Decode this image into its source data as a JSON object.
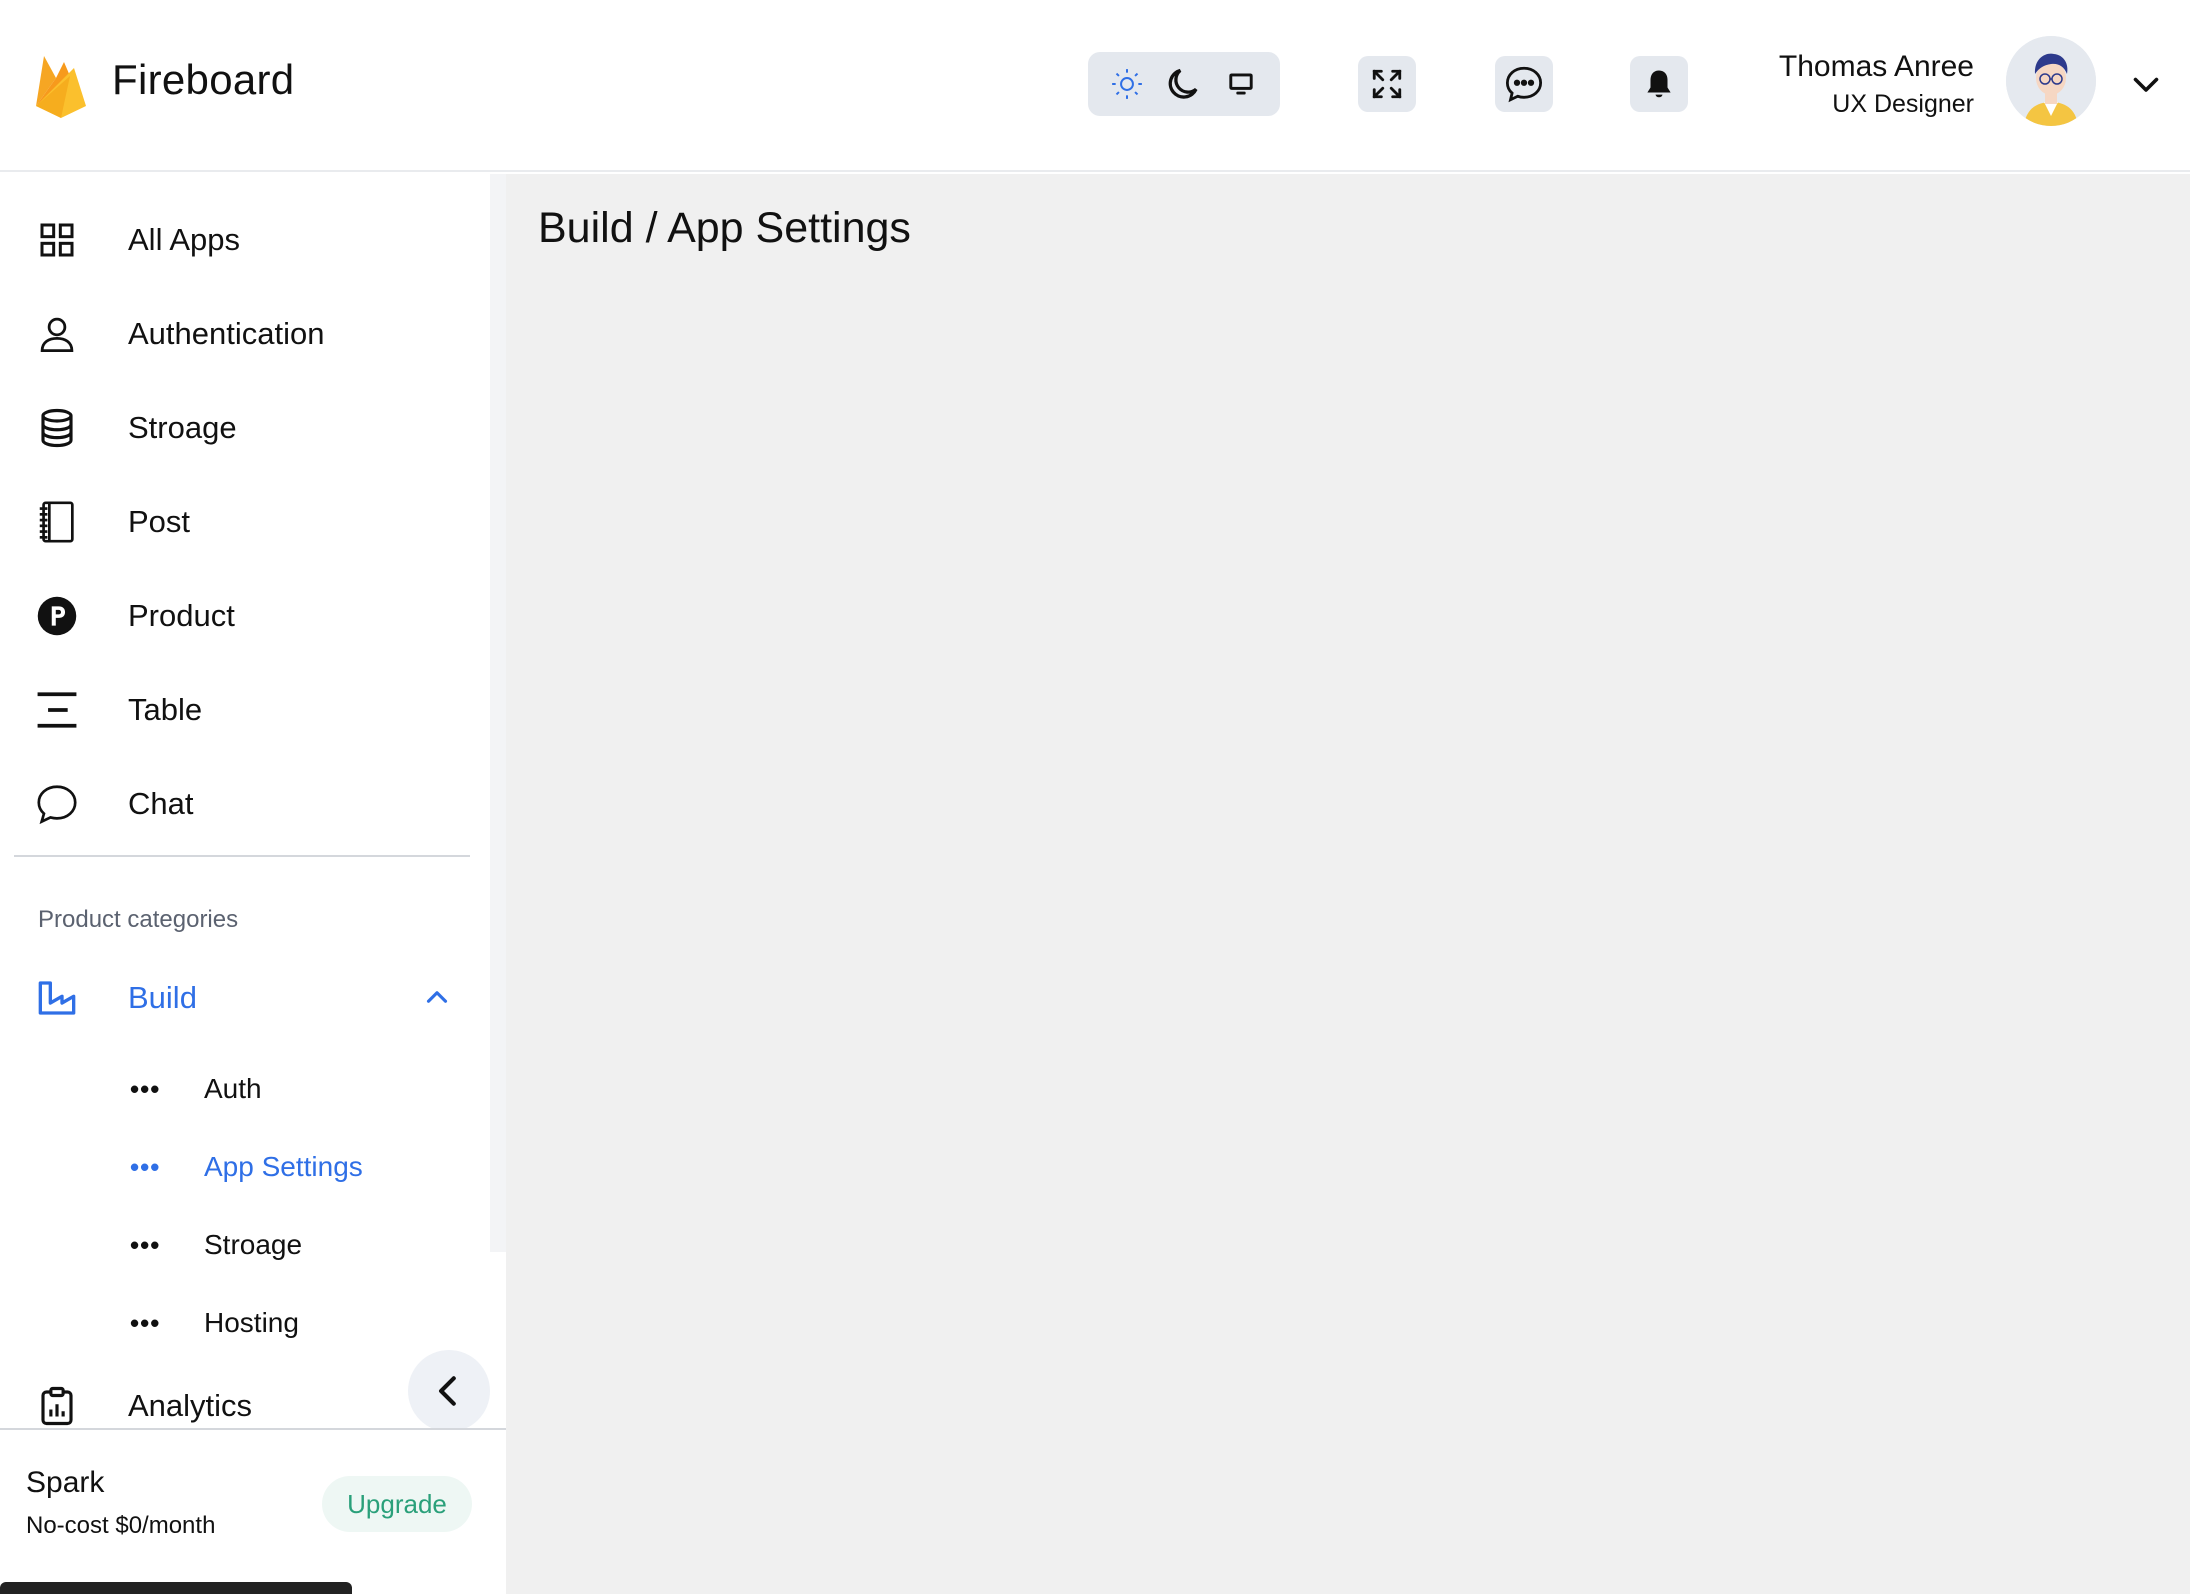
{
  "app": {
    "name": "Fireboard"
  },
  "header": {
    "theme_options": [
      {
        "icon": "sun-icon",
        "active": true
      },
      {
        "icon": "moon-icon",
        "active": false
      },
      {
        "icon": "monitor-icon",
        "active": false
      }
    ],
    "icons": [
      "fullscreen-icon",
      "chat-bubble-icon",
      "bell-icon"
    ],
    "user": {
      "name": "Thomas Anree",
      "role": "UX Designer"
    }
  },
  "sidebar": {
    "items": [
      {
        "label": "All Apps",
        "icon": "grid-icon"
      },
      {
        "label": "Authentication",
        "icon": "user-icon"
      },
      {
        "label": "Stroage",
        "icon": "database-icon"
      },
      {
        "label": "Post",
        "icon": "notebook-icon"
      },
      {
        "label": "Product",
        "icon": "product-p-icon"
      },
      {
        "label": "Table",
        "icon": "table-icon"
      },
      {
        "label": "Chat",
        "icon": "chat-icon"
      }
    ],
    "section_title": "Product categories",
    "build": {
      "label": "Build",
      "icon": "build-icon",
      "expanded": true,
      "children": [
        {
          "label": "Auth",
          "active": false
        },
        {
          "label": "App Settings",
          "active": true
        },
        {
          "label": "Stroage",
          "active": false
        },
        {
          "label": "Hosting",
          "active": false
        }
      ]
    },
    "analytics": {
      "label": "Analytics",
      "icon": "clipboard-chart-icon"
    },
    "plan": {
      "name": "Spark",
      "price": "No-cost $0/month",
      "upgrade_label": "Upgrade"
    }
  },
  "main": {
    "breadcrumb": "Build / App Settings"
  },
  "colors": {
    "accent": "#2f6fe6",
    "upgrade": "#2aa07a",
    "main_bg": "#f0f0f0"
  }
}
